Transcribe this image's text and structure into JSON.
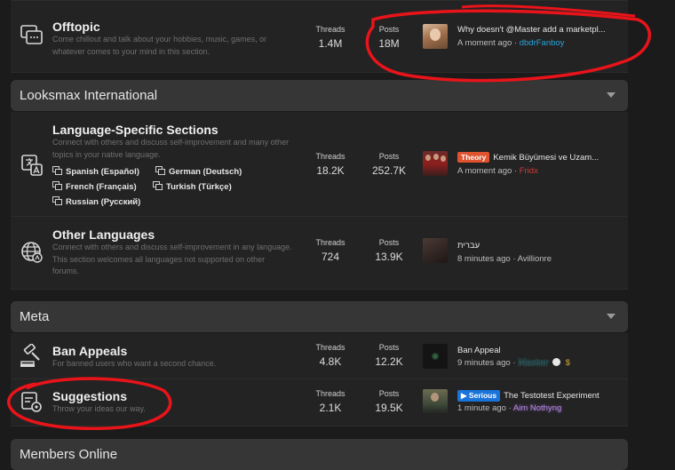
{
  "offtopic": {
    "title": "Offtopic",
    "description": "Come chillout and talk about your hobbies, music, games, or whatever comes to your mind in this section.",
    "threads_label": "Threads",
    "threads": "1.4M",
    "posts_label": "Posts",
    "posts": "18M",
    "last_title": "Why doesn't @Master add a marketpl...",
    "last_time": "A moment ago",
    "last_sep": "·",
    "last_user": "dbdrFanboy"
  },
  "cat_looksmax": {
    "title": "Looksmax International"
  },
  "lang_specific": {
    "title": "Language-Specific Sections",
    "description": "Connect with others and discuss self-improvement and many other topics in your native language.",
    "subforums": [
      "Spanish (Español)",
      "German (Deutsch)",
      "French (Français)",
      "Turkish (Türkçe)",
      "Russian (Русский)"
    ],
    "threads_label": "Threads",
    "threads": "18.2K",
    "posts_label": "Posts",
    "posts": "252.7K",
    "last_prefix": "Theory",
    "last_title": "Kemik Büyümesi ve Uzam...",
    "last_time": "A moment ago",
    "last_sep": "·",
    "last_user": "Fridx"
  },
  "other_languages": {
    "title": "Other Languages",
    "description": "Connect with others and discuss self-improvement in any language. This section welcomes all languages not supported on other forums.",
    "threads_label": "Threads",
    "threads": "724",
    "posts_label": "Posts",
    "posts": "13.9K",
    "last_title": "עברית",
    "last_time": "8 minutes ago",
    "last_sep": "·",
    "last_user": "Avillionre"
  },
  "cat_meta": {
    "title": "Meta"
  },
  "ban_appeals": {
    "title": "Ban Appeals",
    "description": "For banned users who want a second chance.",
    "threads_label": "Threads",
    "threads": "4.8K",
    "posts_label": "Posts",
    "posts": "12.2K",
    "last_title": "Ban Appeal",
    "last_time": "9 minutes ago",
    "last_sep": "·",
    "last_user": "Master"
  },
  "suggestions": {
    "title": "Suggestions",
    "description": "Throw your ideas our way.",
    "threads_label": "Threads",
    "threads": "2.1K",
    "posts_label": "Posts",
    "posts": "19.5K",
    "last_prefix": "Serious",
    "last_title": "The Testotest Experiment",
    "last_time": "1 minute ago",
    "last_sep": "·",
    "last_user": "Aim Nothyng"
  },
  "members_online": {
    "title": "Members Online"
  },
  "colors": {
    "background": "#1b1b1b",
    "node_bg": "#232323",
    "category_bg": "#363636",
    "theory_label": "#e0532f",
    "serious_label": "#1a73d9",
    "user_blue": "#2aa3d8",
    "user_red": "#d23a3a",
    "user_purple": "#b38bd8",
    "annotation_red": "#e8141a"
  }
}
